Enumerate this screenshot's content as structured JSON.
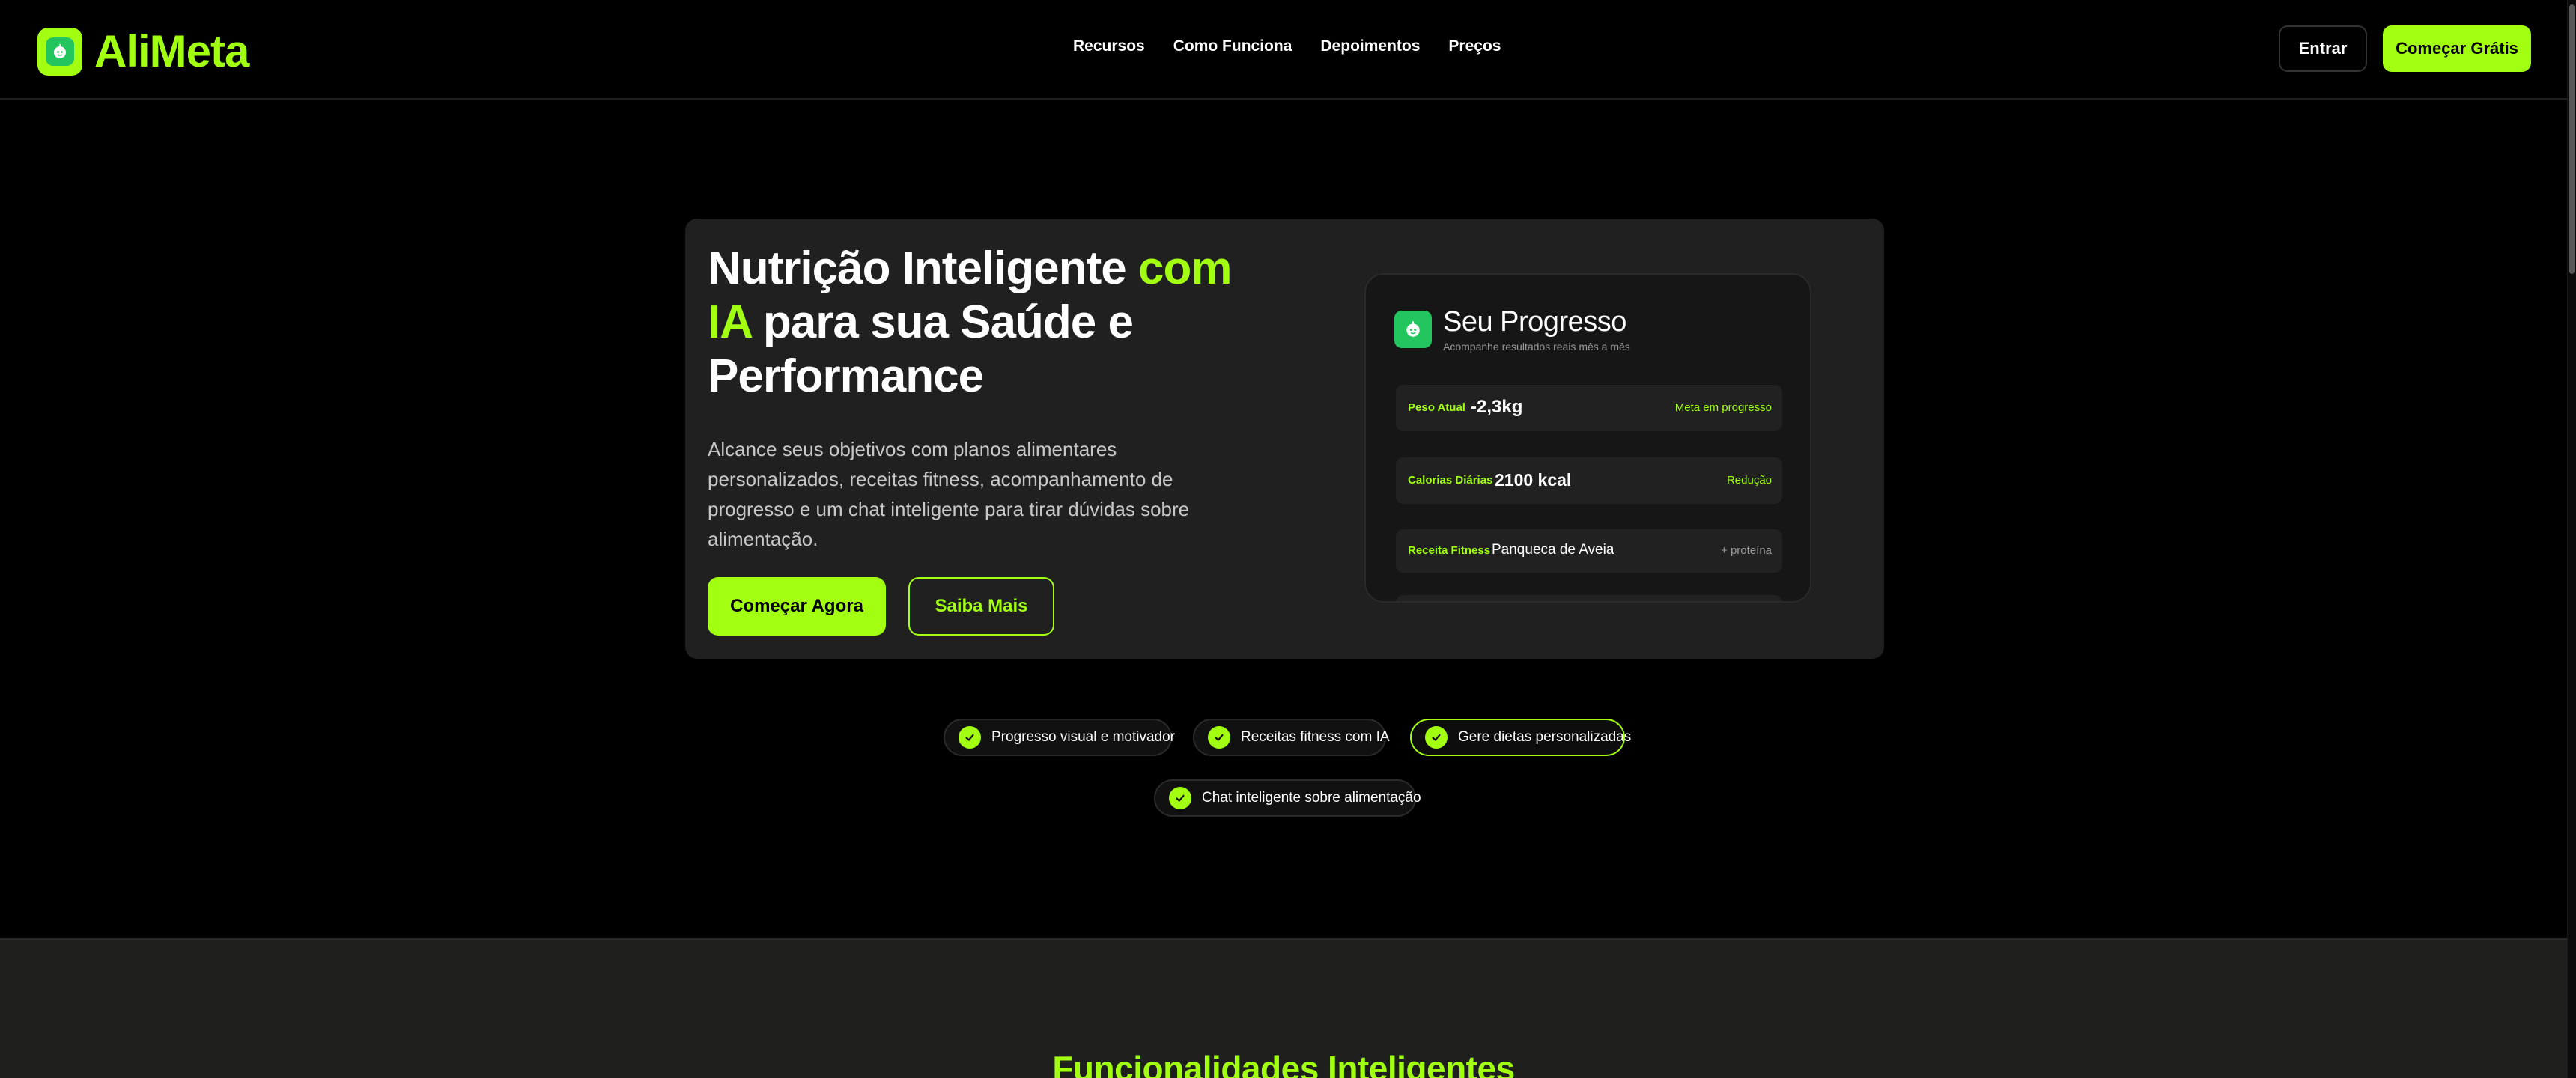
{
  "brand": {
    "name": "AliMeta",
    "logo_icon": "apple-icon",
    "accent_color": "#a3ff12",
    "icon_green": "#22c55e"
  },
  "nav": {
    "items": [
      {
        "label": "Recursos"
      },
      {
        "label": "Como Funciona"
      },
      {
        "label": "Depoimentos"
      },
      {
        "label": "Preços"
      }
    ],
    "login_label": "Entrar",
    "start_free_label": "Começar Grátis"
  },
  "hero": {
    "title_part1": "Nutrição Inteligente ",
    "title_accent_1": "com",
    "title_accent_2": "IA",
    "title_part2": " para sua Saúde e",
    "title_part3": "Performance",
    "description": "Alcance seus objetivos com planos alimentares personalizados, receitas fitness, acompanhamento de progresso e um chat inteligente para tirar dúvidas sobre alimentação.",
    "primary_button": "Começar Agora",
    "secondary_button": "Saiba Mais"
  },
  "progress_card": {
    "title": "Seu Progresso",
    "subtitle": "Acompanhe resultados reais mês a mês",
    "rows": [
      {
        "label": "Peso Atual",
        "value": "-2,3kg",
        "right": "Meta em progresso"
      },
      {
        "label": "Calorias Diárias",
        "value": "2100 kcal",
        "right": "Redução"
      },
      {
        "label": "Receita Fitness",
        "value": "Panqueca de Aveia",
        "right": "+ proteína"
      }
    ]
  },
  "features": [
    {
      "label": "Progresso visual e motivador",
      "active": false
    },
    {
      "label": "Receitas fitness com IA",
      "active": false
    },
    {
      "label": "Gere dietas personalizadas",
      "active": true
    },
    {
      "label": "Chat inteligente sobre alimentação",
      "active": false
    }
  ],
  "section": {
    "title": "Funcionalidades Inteligentes"
  }
}
